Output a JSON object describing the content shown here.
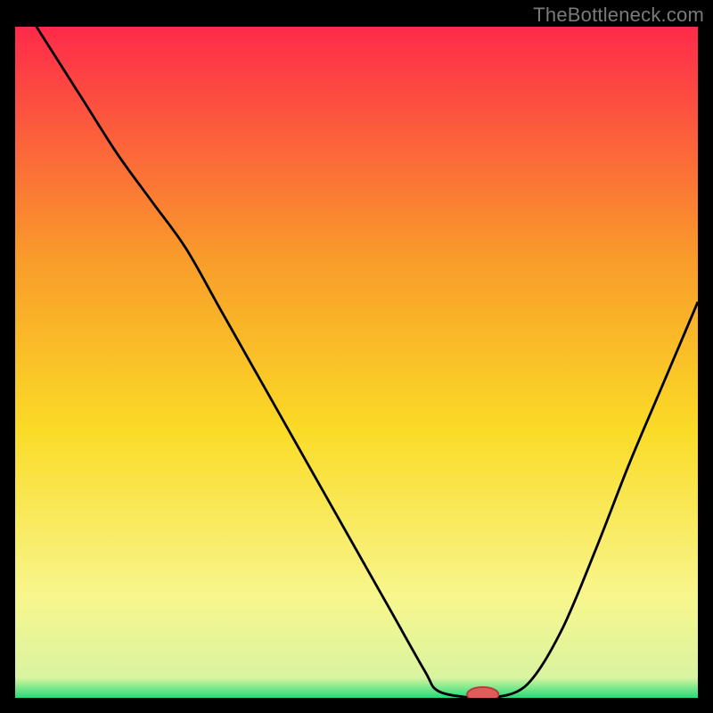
{
  "watermark": "TheBottleneck.com",
  "colors": {
    "gradient_top": "#fe2a4a",
    "gradient_upper_mid": "#f99d2a",
    "gradient_mid": "#fadb26",
    "gradient_lower_mid": "#f8f68d",
    "gradient_bottom": "#22dd78",
    "curve": "#000000",
    "marker_fill": "#e45b5b",
    "marker_stroke": "#b93b3b",
    "background": "#000000"
  },
  "chart_data": {
    "type": "line",
    "title": "",
    "xlabel": "",
    "ylabel": "",
    "xlim": [
      0,
      100
    ],
    "ylim": [
      0,
      100
    ],
    "series": [
      {
        "name": "bottleneck-curve",
        "x": [
          0,
          5,
          10,
          15,
          20,
          25,
          30,
          35,
          40,
          45,
          50,
          55,
          60,
          62,
          67,
          70,
          75,
          80,
          85,
          90,
          95,
          100
        ],
        "y": [
          105,
          97,
          89,
          81,
          74,
          67,
          58,
          49,
          40,
          31,
          22,
          13,
          4,
          1,
          0,
          0,
          2,
          10,
          22,
          35,
          47,
          59
        ]
      }
    ],
    "marker": {
      "x": 68.5,
      "y": 0.5,
      "label": "optimal-point"
    }
  }
}
